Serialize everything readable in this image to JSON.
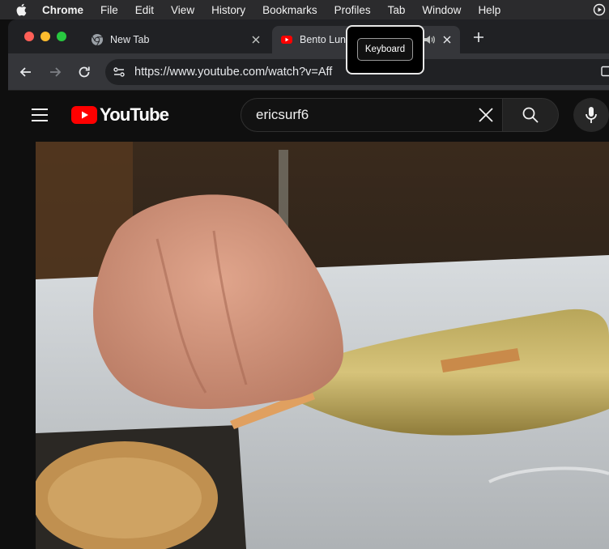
{
  "menubar": {
    "items": [
      "Chrome",
      "File",
      "Edit",
      "View",
      "History",
      "Bookmarks",
      "Profiles",
      "Tab",
      "Window",
      "Help"
    ]
  },
  "tabs": [
    {
      "title": "New Tab",
      "icon": "chrome-icon",
      "active": false
    },
    {
      "title": "Bento Lunch",
      "icon": "youtube-icon",
      "active": true
    }
  ],
  "omnibox": {
    "url": "https://www.youtube.com/watch?v=Aff"
  },
  "tooltip": {
    "text": "Keyboard"
  },
  "youtube": {
    "logo_text": "YouTube",
    "search_query": "ericsurf6"
  },
  "colors": {
    "youtube_red": "#ff0000",
    "tab_strip": "#202124",
    "toolbar": "#35363a",
    "page_bg": "#0f0f0f"
  }
}
